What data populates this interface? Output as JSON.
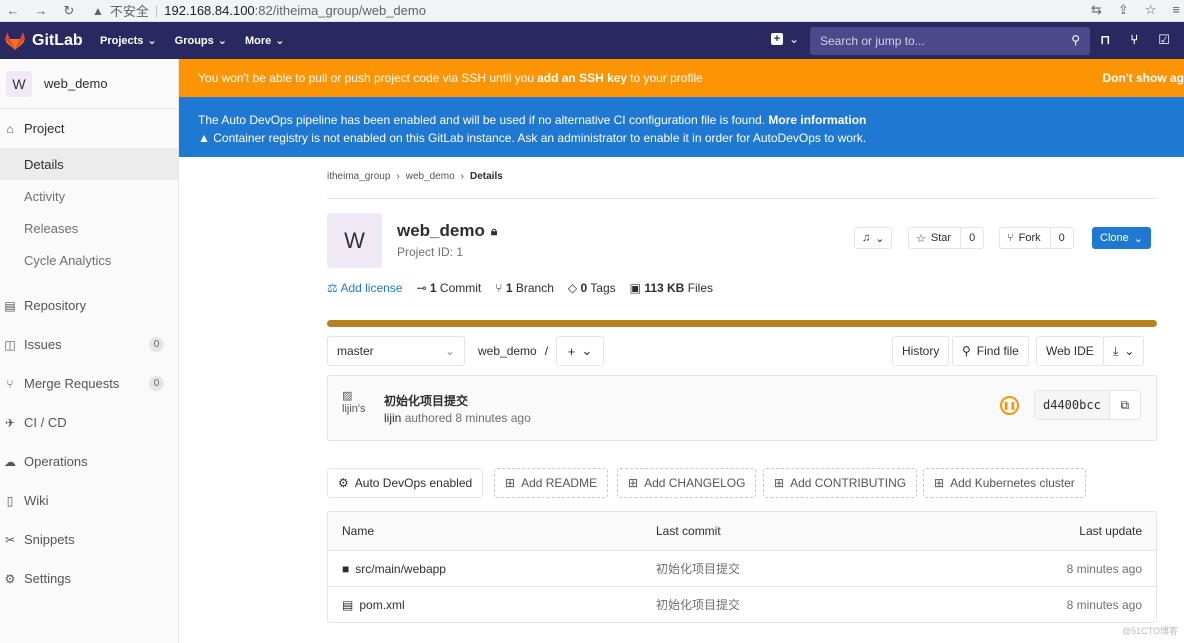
{
  "browser": {
    "insecure": "不安全",
    "host": "192.168.84.100",
    "path": ":82/itheima_group/web_demo"
  },
  "header": {
    "brand": "GitLab",
    "nav": [
      "Projects",
      "Groups",
      "More"
    ],
    "search_placeholder": "Search or jump to..."
  },
  "sidebar": {
    "avatar_letter": "W",
    "project_name": "web_demo",
    "project_label": "Project",
    "sub_items": [
      "Details",
      "Activity",
      "Releases",
      "Cycle Analytics"
    ],
    "items": [
      {
        "label": "Repository",
        "icon": "repository-icon"
      },
      {
        "label": "Issues",
        "icon": "issues-icon",
        "badge": "0"
      },
      {
        "label": "Merge Requests",
        "icon": "merge-request-icon",
        "badge": "0"
      },
      {
        "label": "CI / CD",
        "icon": "rocket-icon"
      },
      {
        "label": "Operations",
        "icon": "cloud-icon"
      },
      {
        "label": "Wiki",
        "icon": "book-icon"
      },
      {
        "label": "Snippets",
        "icon": "scissors-icon"
      },
      {
        "label": "Settings",
        "icon": "gear-icon"
      }
    ]
  },
  "banners": {
    "ssh_pre": "You won't be able to pull or push project code via SSH until you",
    "ssh_link": "add an SSH key",
    "ssh_post": "to your profile",
    "ssh_dismiss": "Don't show ag",
    "devops_text": "The Auto DevOps pipeline has been enabled and will be used if no alternative CI configuration file is found.",
    "devops_link": "More information",
    "registry_text": "Container registry is not enabled on this GitLab instance. Ask an administrator to enable it in order for AutoDevOps to work."
  },
  "breadcrumb": [
    "itheima_group",
    "web_demo",
    "Details"
  ],
  "project": {
    "avatar_letter": "W",
    "title": "web_demo",
    "id_label": "Project ID: 1",
    "star_label": "Star",
    "star_count": "0",
    "fork_label": "Fork",
    "fork_count": "0",
    "clone_label": "Clone"
  },
  "stats": {
    "license": "Add license",
    "commits_n": "1",
    "commits_l": "Commit",
    "branch_n": "1",
    "branch_l": "Branch",
    "tags_n": "0",
    "tags_l": "Tags",
    "files_n": "113 KB",
    "files_l": "Files"
  },
  "repo_bar": {
    "branch": "master",
    "path": "web_demo",
    "path_sep": "/",
    "history": "History",
    "find_file": "Find file",
    "web_ide": "Web IDE"
  },
  "commit": {
    "avatar_alt": "lijin's",
    "message": "初始化项目提交",
    "author": "lijin",
    "meta": "authored 8 minutes ago",
    "sha": "d4400bcc"
  },
  "quick_actions": [
    "Auto DevOps enabled",
    "Add README",
    "Add CHANGELOG",
    "Add CONTRIBUTING",
    "Add Kubernetes cluster"
  ],
  "files": {
    "headers": [
      "Name",
      "Last commit",
      "Last update"
    ],
    "rows": [
      {
        "name": "src/main/webapp",
        "type": "folder",
        "commit": "初始化项目提交",
        "updated": "8 minutes ago"
      },
      {
        "name": "pom.xml",
        "type": "file",
        "commit": "初始化项目提交",
        "updated": "8 minutes ago"
      }
    ]
  },
  "watermark": "@51CTO博客",
  "colors": {
    "header": "#292961",
    "orange": "#fc9403",
    "blue": "#1f78d1",
    "progress": "#b5821f"
  }
}
